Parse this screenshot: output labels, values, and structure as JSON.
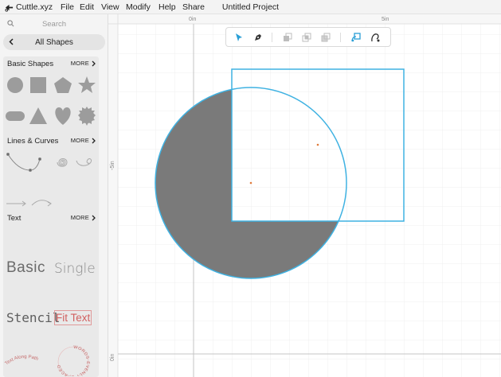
{
  "app": {
    "name": "Cuttle.xyz"
  },
  "menu": {
    "items": [
      "File",
      "Edit",
      "View",
      "Modify",
      "Help",
      "Share"
    ]
  },
  "project": {
    "title": "Untitled Project"
  },
  "sidebar": {
    "search_placeholder": "Search",
    "all_shapes_label": "All Shapes",
    "basic_shapes": {
      "title": "Basic Shapes",
      "more_label": "MORE"
    },
    "lines_curves": {
      "title": "Lines & Curves",
      "more_label": "MORE"
    },
    "text": {
      "title": "Text",
      "more_label": "MORE",
      "samples": {
        "basic": "Basic",
        "single": "Single",
        "stencil": "Stencil",
        "fit_text": "Fit Text",
        "text_along_path": "Text Along Path",
        "words_evenly_spaced": "WORDS EVENLY SPACED"
      }
    }
  },
  "rulers": {
    "top": [
      "0in",
      "5in"
    ],
    "left": [
      "-5in",
      "0in"
    ]
  },
  "colors": {
    "accent": "#3cb4e5",
    "selection": "#3fb2e2",
    "fill": "#7a7a7a",
    "grid": "#efefef",
    "grid_major": "#e2e2e2",
    "axis": "#c5c5c5"
  },
  "toolbar": {
    "tools": [
      "pointer-tool-icon",
      "pen-tool-icon",
      "union-icon",
      "difference-icon",
      "intersect-icon",
      "link-icon",
      "pen-path-icon"
    ]
  }
}
